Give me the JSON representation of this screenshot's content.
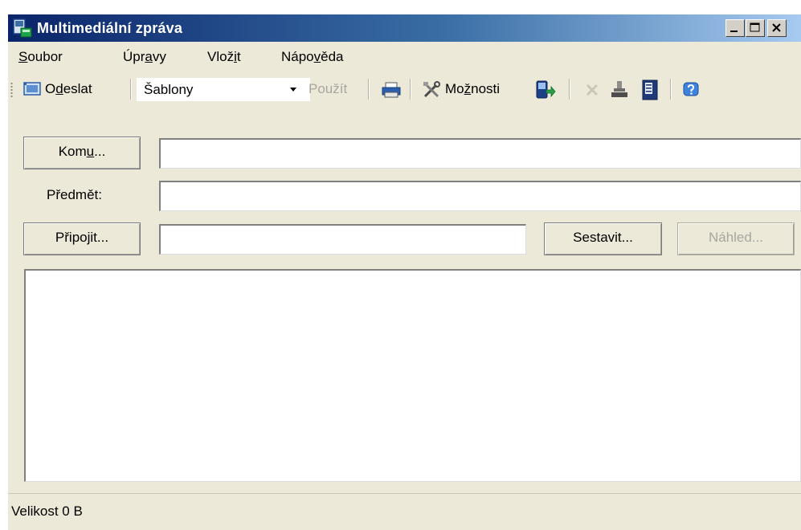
{
  "window": {
    "title": "Multimediální zpráva"
  },
  "menu": {
    "items": [
      {
        "pre": "",
        "key": "S",
        "post": "oubor"
      },
      {
        "pre": "Úpr",
        "key": "a",
        "post": "vy"
      },
      {
        "pre": "Vlož",
        "key": "i",
        "post": "t"
      },
      {
        "pre": "Nápo",
        "key": "v",
        "post": "ěda"
      }
    ]
  },
  "toolbar": {
    "send": {
      "pre": "O",
      "key": "d",
      "post": "eslat"
    },
    "templates_value": "Šablony",
    "apply_label": "Použít",
    "options": {
      "pre": "Mo",
      "key": "ž",
      "post": "nosti"
    },
    "icons": [
      "send-icon",
      "print-icon",
      "tools-icon",
      "phone-export-icon",
      "delete-icon",
      "stamp-icon",
      "document-icon",
      "help-icon"
    ]
  },
  "form": {
    "to_button": {
      "pre": "Kom",
      "key": "u",
      "post": "..."
    },
    "to_value": "",
    "subject_label": "Předmět:",
    "subject_value": "",
    "attach_button": "Připojit...",
    "attach_value": "",
    "compose_button": "Sestavit...",
    "preview_button": "Náhled...",
    "body_value": ""
  },
  "status": {
    "text": "Velikost 0 B"
  },
  "colors": {
    "titlebar_start": "#0a246a",
    "titlebar_end": "#a6caf0",
    "window_face": "#ece9d8",
    "disabled_text": "#a7a6a0"
  }
}
